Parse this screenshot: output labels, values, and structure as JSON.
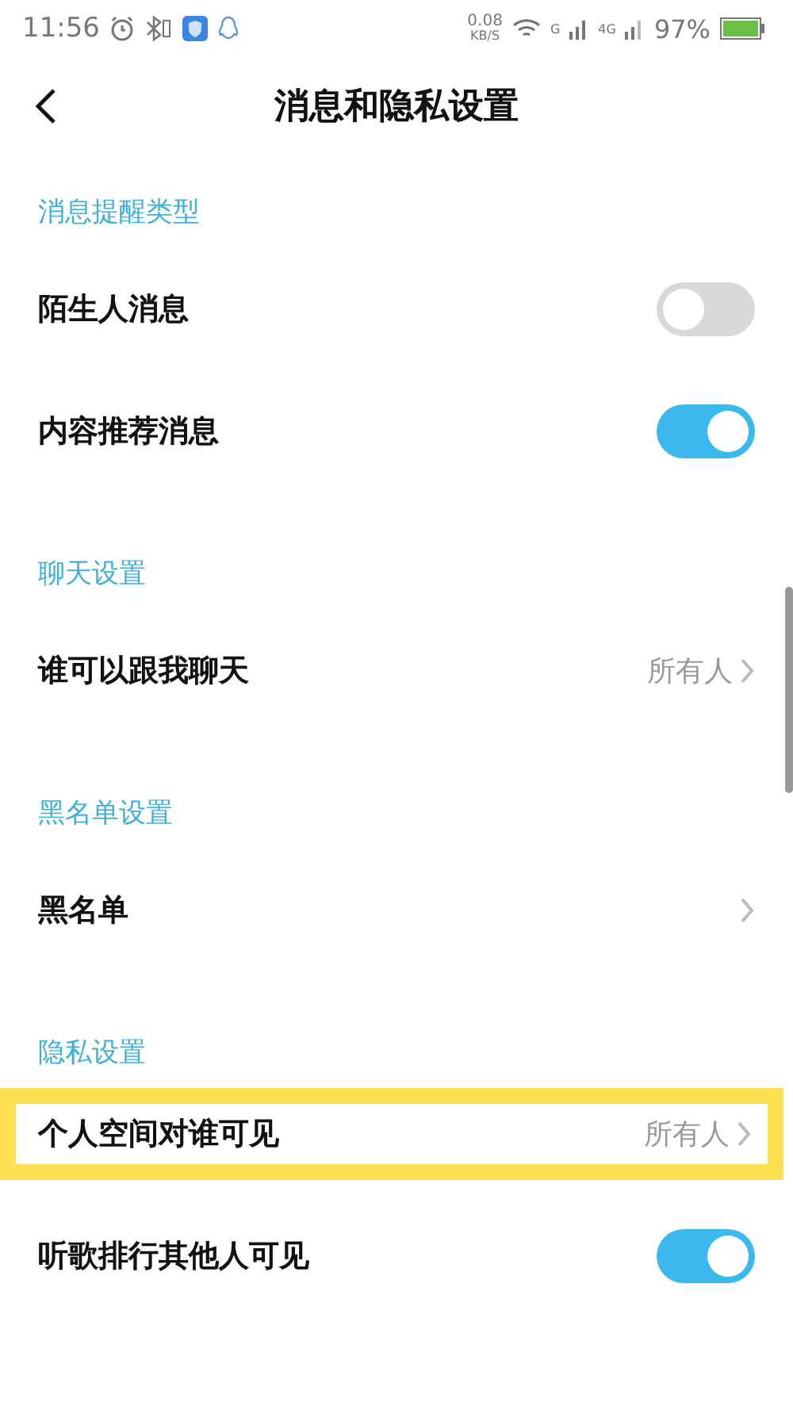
{
  "status_bar": {
    "time": "11:56",
    "net_speed": "0.08",
    "net_unit": "KB/S",
    "sim1": "G",
    "sim2": "4G",
    "battery": "97%"
  },
  "header": {
    "title": "消息和隐私设置"
  },
  "sections": [
    {
      "title": "消息提醒类型",
      "items": [
        {
          "kind": "toggle",
          "label": "陌生人消息",
          "on": false,
          "highlighted": false
        },
        {
          "kind": "toggle",
          "label": "内容推荐消息",
          "on": true,
          "highlighted": false
        }
      ]
    },
    {
      "title": "聊天设置",
      "items": [
        {
          "kind": "nav",
          "label": "谁可以跟我聊天",
          "value": "所有人",
          "highlighted": false
        }
      ]
    },
    {
      "title": "黑名单设置",
      "items": [
        {
          "kind": "nav",
          "label": "黑名单",
          "highlighted": false
        }
      ]
    },
    {
      "title": "隐私设置",
      "items": [
        {
          "kind": "nav",
          "label": "个人空间对谁可见",
          "value": "所有人",
          "highlighted": true
        },
        {
          "kind": "toggle",
          "label": "听歌排行其他人可见",
          "on": true,
          "highlighted": false
        }
      ]
    }
  ]
}
